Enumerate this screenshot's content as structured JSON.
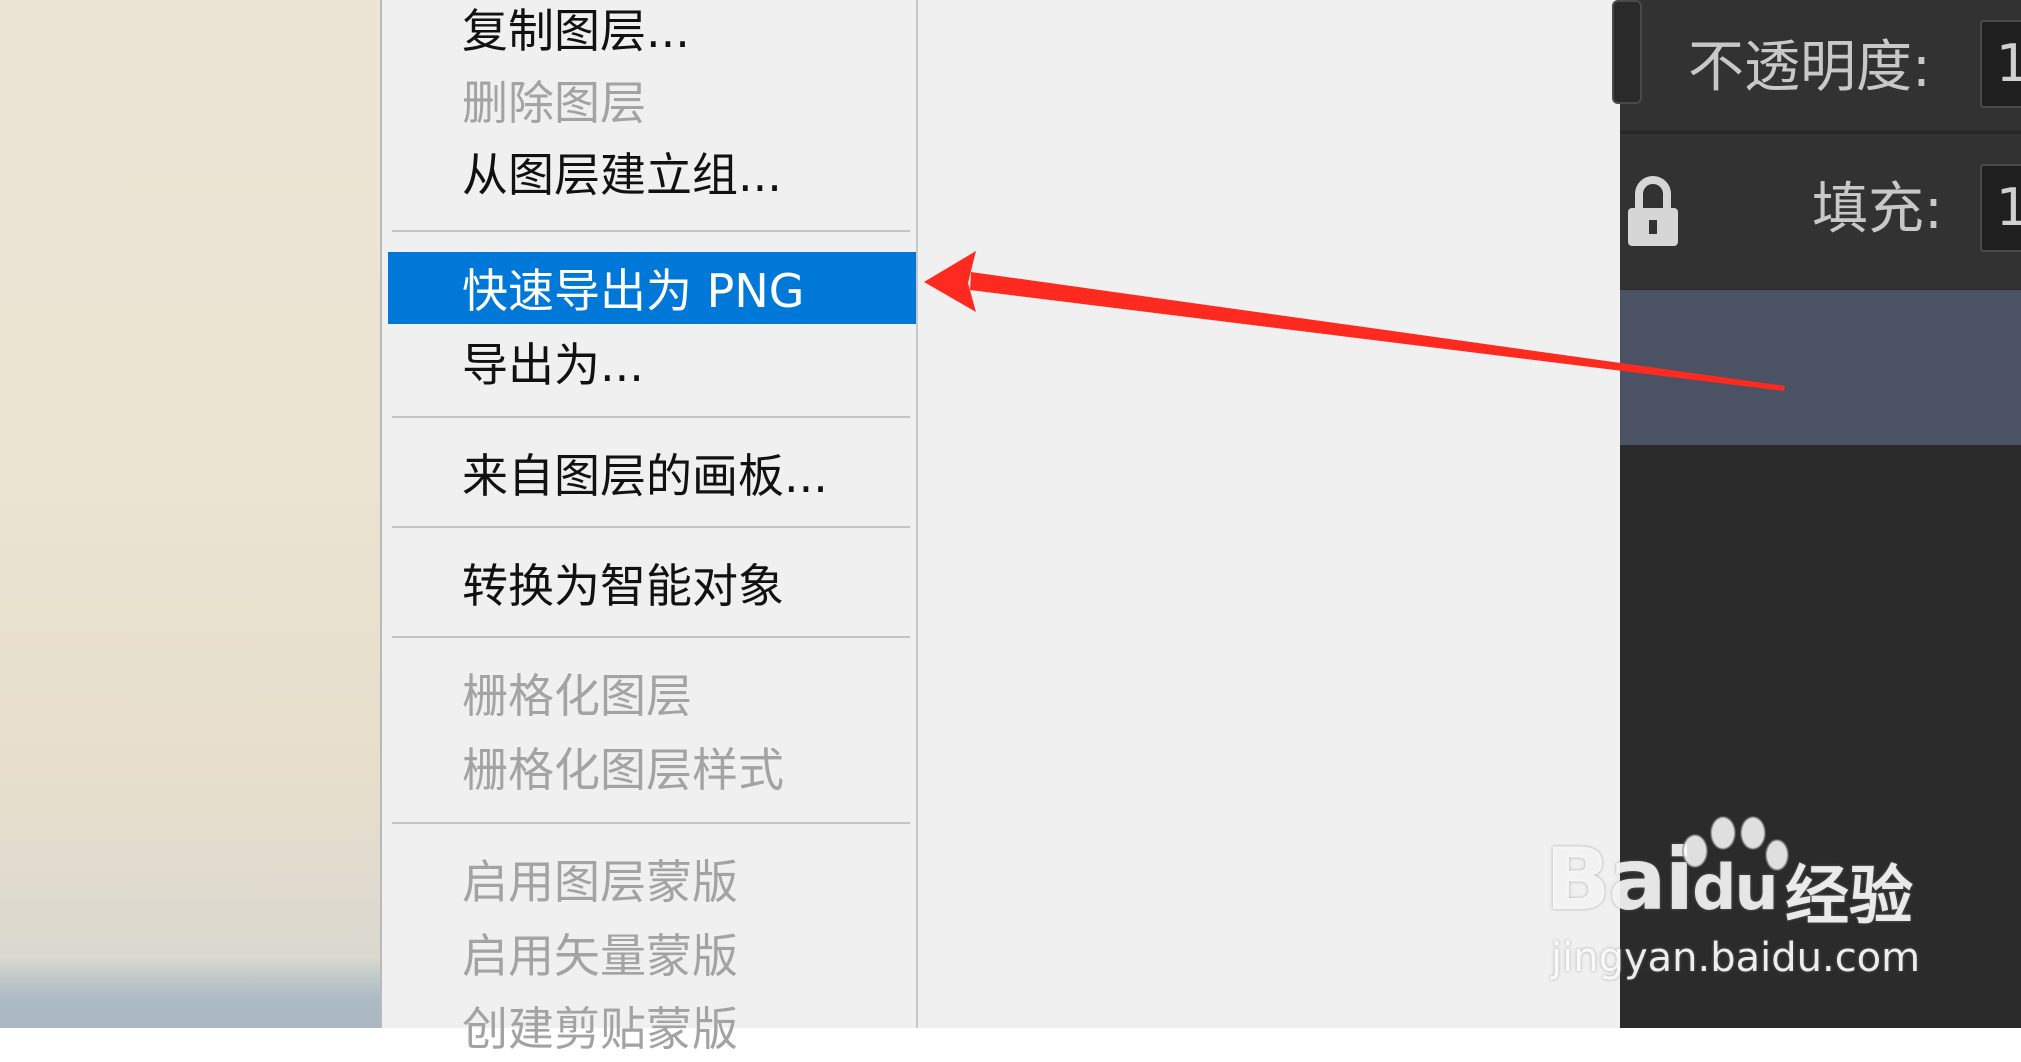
{
  "context_menu": {
    "items": [
      {
        "label": "复制图层...",
        "state": "enabled"
      },
      {
        "label": "删除图层",
        "state": "disabled"
      },
      {
        "label": "从图层建立组...",
        "state": "enabled"
      },
      {
        "label": "快速导出为 PNG",
        "state": "highlighted"
      },
      {
        "label": "导出为...",
        "state": "enabled"
      },
      {
        "label": "来自图层的画板...",
        "state": "enabled"
      },
      {
        "label": "转换为智能对象",
        "state": "enabled"
      },
      {
        "label": "栅格化图层",
        "state": "disabled"
      },
      {
        "label": "栅格化图层样式",
        "state": "disabled"
      },
      {
        "label": "启用图层蒙版",
        "state": "disabled"
      },
      {
        "label": "启用矢量蒙版",
        "state": "disabled"
      },
      {
        "label": "创建剪贴蒙版",
        "state": "disabled"
      }
    ]
  },
  "layers_panel": {
    "opacity_label": "不透明度:",
    "opacity_value": "1",
    "fill_label": "填充:",
    "fill_value": "1",
    "lock_icon": "lock-icon"
  },
  "annotation": {
    "color": "#ff2a1f",
    "points_to": "快速导出为 PNG"
  },
  "watermark": {
    "brand": "Bai",
    "brand_du": "du",
    "suffix": "经验",
    "url": "jingyan.baidu.com"
  },
  "colors": {
    "highlight": "#0078d7",
    "menu_bg": "#f0f0f0",
    "panel_bg": "#2b2b2b",
    "selected_layer": "#4b5263"
  }
}
